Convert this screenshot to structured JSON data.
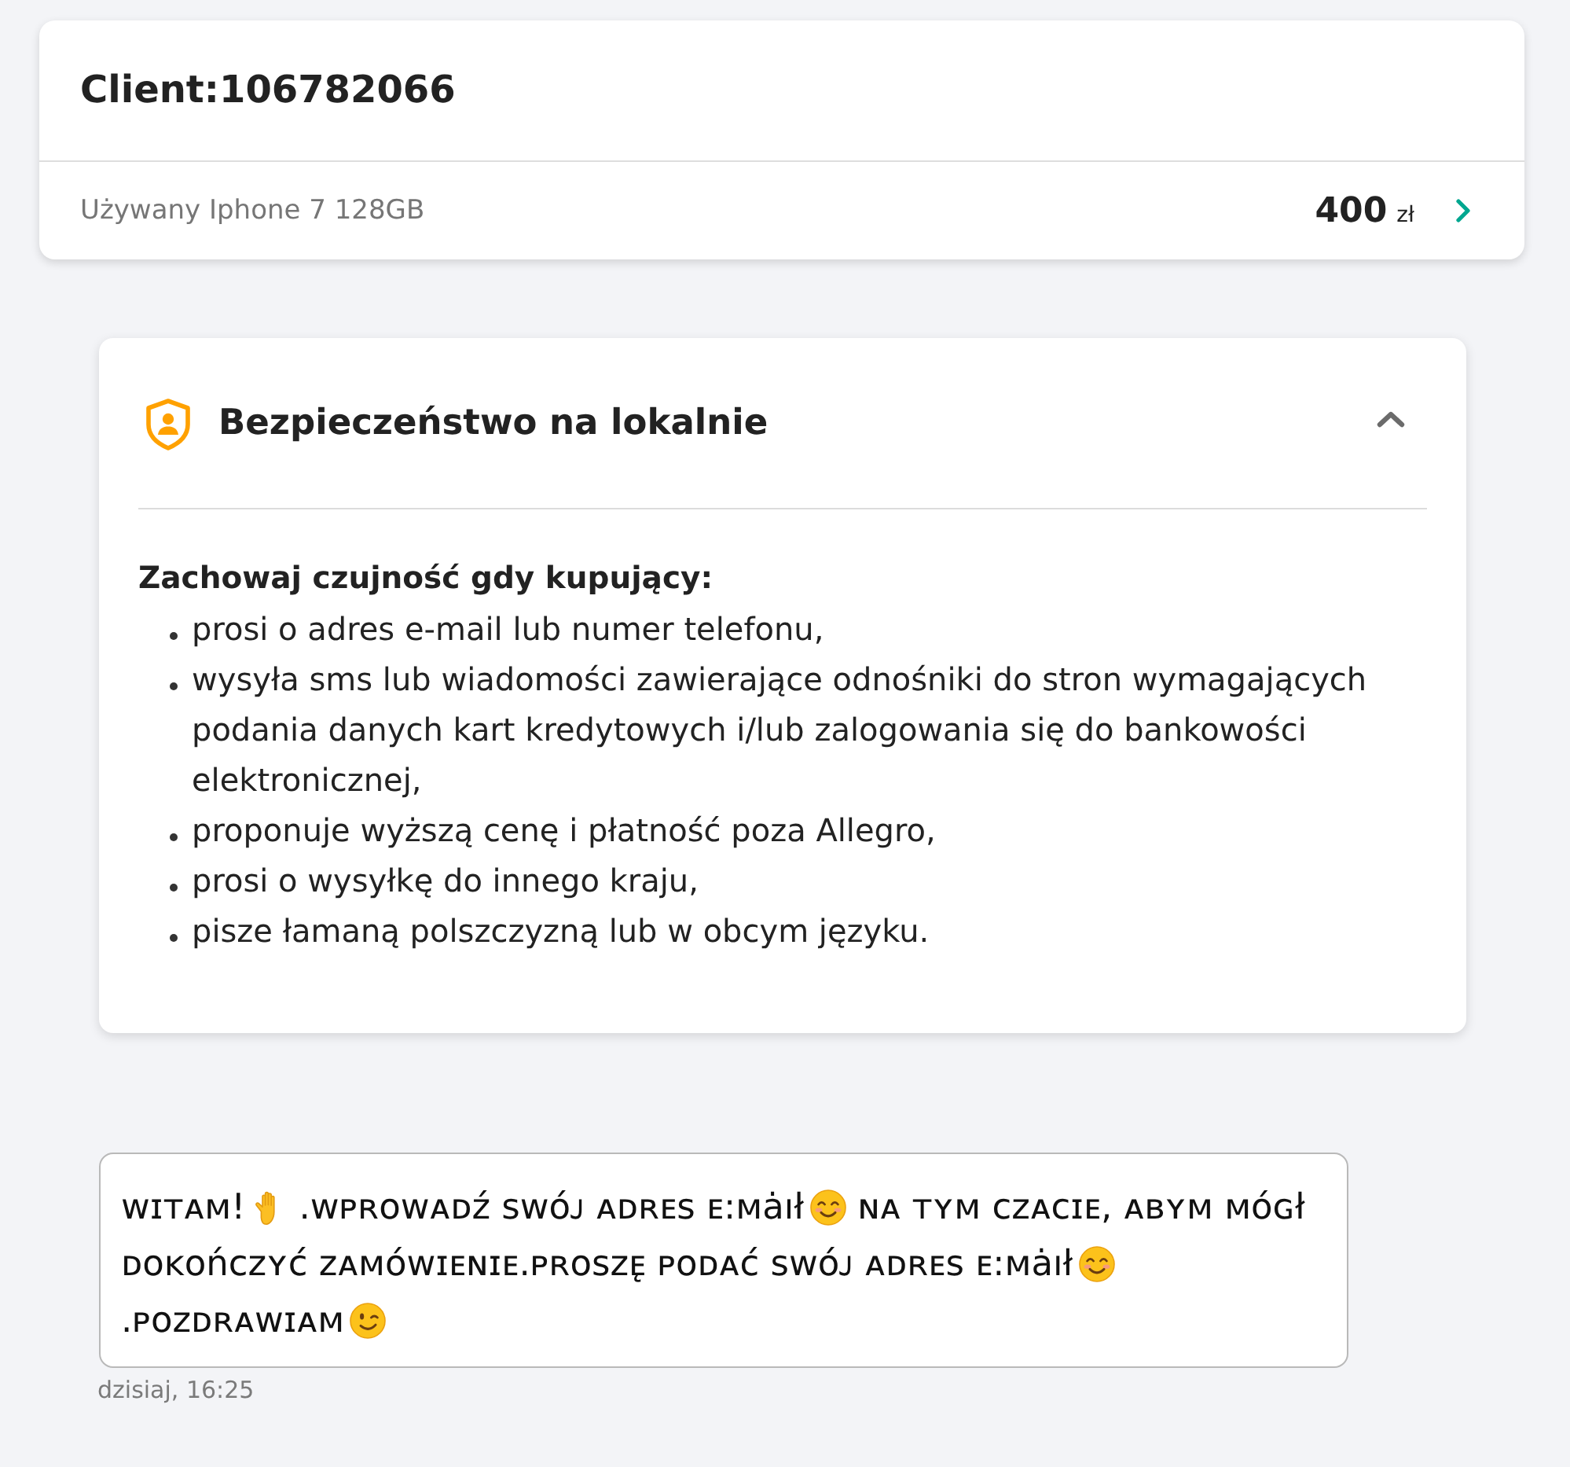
{
  "header": {
    "title": "Client:106782066",
    "product": "Używany Iphone 7 128GB",
    "price": "400",
    "currency": "zł"
  },
  "safety": {
    "title": "Bezpieczeństwo na lokalnie",
    "expanded": true,
    "lead": "Zachowaj czujność gdy kupujący:",
    "items": [
      "prosi o adres e-mail lub numer telefonu,",
      "wysyła sms lub wiadomości zawierające odnośniki do stron wymagających podania danych kart kredytowych i/lub zalogowania się do bankowości elektronicznej,",
      "proponuje wyższą cenę i płatność poza Allegro,",
      "prosi o wysyłkę do innego kraju,",
      "pisze łamaną polszczyzną lub w obcym języku."
    ]
  },
  "message": {
    "lines": [
      [
        {
          "kind": "text",
          "text": "ᴡɪᴛᴀᴍ!"
        },
        {
          "kind": "hand"
        },
        {
          "kind": "text",
          "text": ".ᴡᴘʀᴏᴡᴀᴅᴢ́ sᴡᴏ́ᴊ ᴀᴅʀᴇs ᴇ:ᴍȧıł"
        },
        {
          "kind": "smile"
        },
        {
          "kind": "text",
          "text": "ɴᴀ ᴛʏᴍ ᴄᴢᴀᴄɪᴇ, ᴀʙʏᴍ ᴍᴏ́ɢł"
        }
      ],
      [
        {
          "kind": "text",
          "text": "ᴅᴏᴋᴏńᴄᴢʏᴄ́ ᴢᴀᴍᴏ́ᴡɪᴇɴɪᴇ.ᴘʀᴏsᴢᴇ̨ ᴘᴏᴅᴀᴄ́ sᴡᴏ́ᴊ ᴀᴅʀᴇs ᴇ:ᴍȧıł"
        },
        {
          "kind": "smile"
        }
      ],
      [
        {
          "kind": "text",
          "text": ".ᴘᴏᴢᴅʀᴀᴡɪᴀᴍ"
        },
        {
          "kind": "wink"
        }
      ]
    ],
    "time": "dzisiaj, 16:25"
  }
}
